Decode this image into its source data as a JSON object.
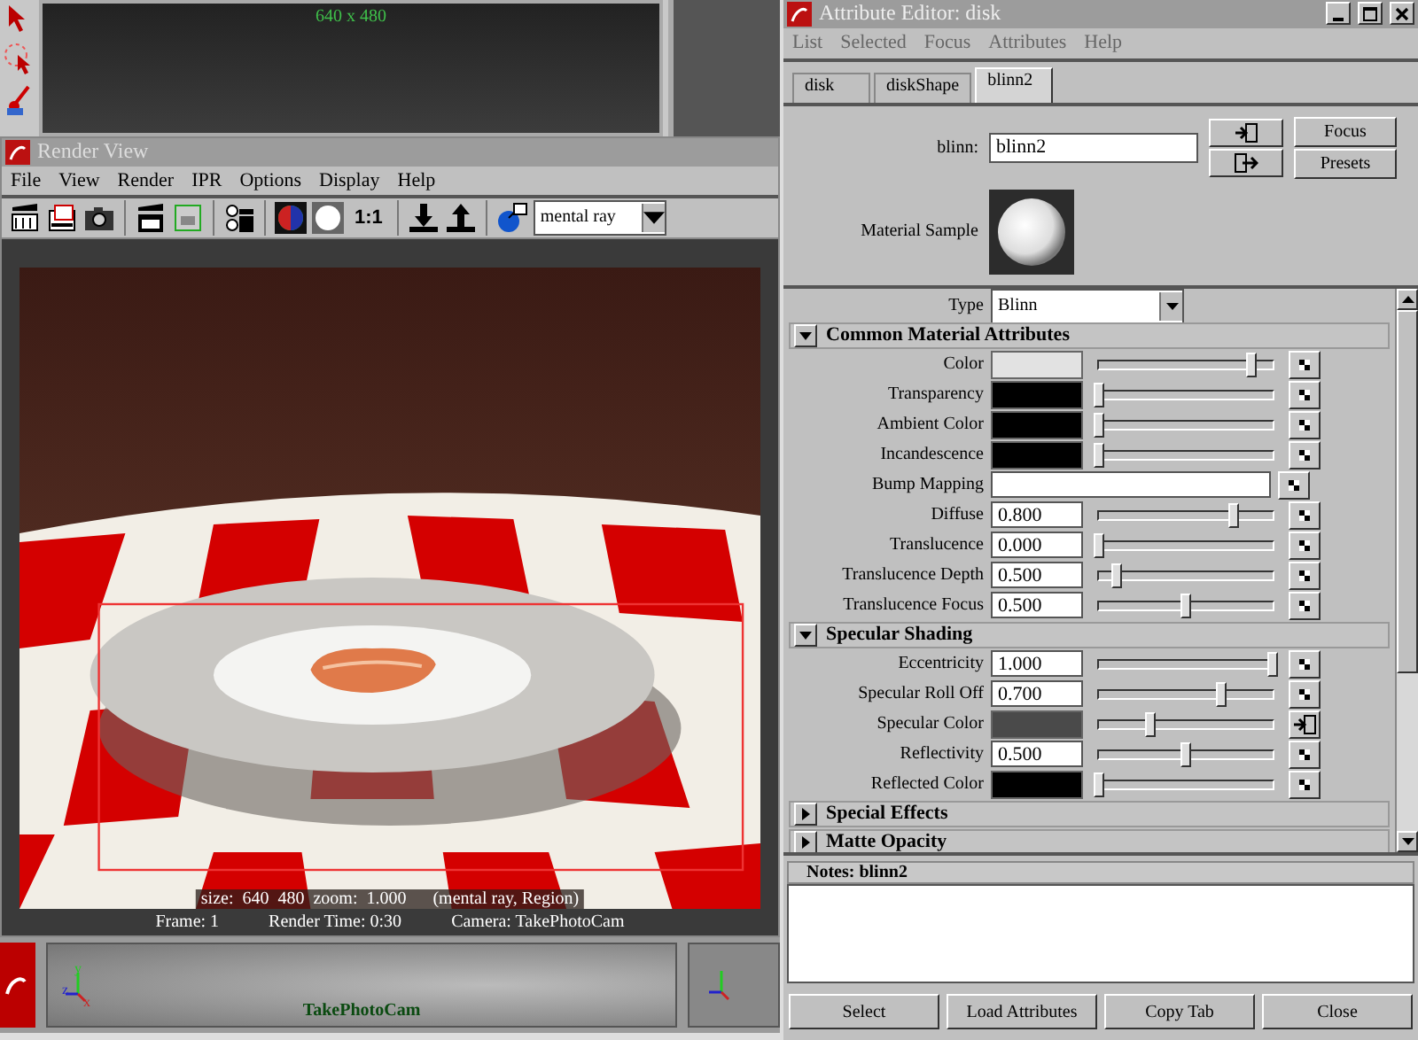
{
  "viewport_top": {
    "resolution": "640 x 480"
  },
  "render_view": {
    "title": "Render View",
    "menu": [
      "File",
      "View",
      "Render",
      "IPR",
      "Options",
      "Display",
      "Help"
    ],
    "ratio_label": "1:1",
    "renderer": "mental ray",
    "overlay": "size:  640  480  zoom:  1.000      (mental ray, Region)",
    "status": [
      "Frame: 1",
      "Render Time: 0:30",
      "Camera: TakePhotoCam"
    ]
  },
  "viewport_bottom": {
    "camera": "TakePhotoCam",
    "axes": [
      "y",
      "z",
      "x"
    ]
  },
  "attribute_editor": {
    "title": "Attribute Editor: disk",
    "menu": [
      "List",
      "Selected",
      "Focus",
      "Attributes",
      "Help"
    ],
    "tabs": [
      {
        "label": "disk",
        "selected": false
      },
      {
        "label": "diskShape",
        "selected": false
      },
      {
        "label": "blinn2",
        "selected": true
      }
    ],
    "node_label": "blinn:",
    "node_name": "blinn2",
    "buttons_side": [
      "Focus",
      "Presets"
    ],
    "sample_label": "Material Sample",
    "type_label": "Type",
    "type_value": "Blinn",
    "sections": [
      {
        "title": "Common Material Attributes",
        "expanded": true,
        "rows": [
          {
            "kind": "color",
            "label": "Color",
            "color": "#e2e2e2",
            "level": 0.88,
            "connected": false
          },
          {
            "kind": "color",
            "label": "Transparency",
            "color": "#000000",
            "level": 0,
            "connected": false
          },
          {
            "kind": "color",
            "label": "Ambient Color",
            "color": "#000000",
            "level": 0,
            "connected": false
          },
          {
            "kind": "color",
            "label": "Incandescence",
            "color": "#000000",
            "level": 0,
            "connected": false
          },
          {
            "kind": "map",
            "label": "Bump Mapping",
            "connected": false
          },
          {
            "kind": "number",
            "label": "Diffuse",
            "value": "0.800",
            "level": 0.78,
            "connected": false
          },
          {
            "kind": "number",
            "label": "Translucence",
            "value": "0.000",
            "level": 0,
            "connected": false
          },
          {
            "kind": "number",
            "label": "Translucence Depth",
            "value": "0.500",
            "level": 0.1,
            "connected": false
          },
          {
            "kind": "number",
            "label": "Translucence Focus",
            "value": "0.500",
            "level": 0.5,
            "connected": false
          }
        ]
      },
      {
        "title": "Specular Shading",
        "expanded": true,
        "rows": [
          {
            "kind": "number",
            "label": "Eccentricity",
            "value": "1.000",
            "level": 1,
            "connected": false
          },
          {
            "kind": "number",
            "label": "Specular Roll Off",
            "value": "0.700",
            "level": 0.7,
            "connected": false
          },
          {
            "kind": "color",
            "label": "Specular Color",
            "color": "#4a4a4a",
            "level": 0.3,
            "connected": true
          },
          {
            "kind": "number",
            "label": "Reflectivity",
            "value": "0.500",
            "level": 0.5,
            "connected": false
          },
          {
            "kind": "color",
            "label": "Reflected Color",
            "color": "#000000",
            "level": 0,
            "connected": false
          }
        ]
      },
      {
        "title": "Special Effects",
        "expanded": false
      },
      {
        "title": "Matte Opacity",
        "expanded": false
      }
    ],
    "notes_label": "Notes:  blinn2",
    "footer_buttons": [
      "Select",
      "Load Attributes",
      "Copy Tab",
      "Close"
    ]
  }
}
